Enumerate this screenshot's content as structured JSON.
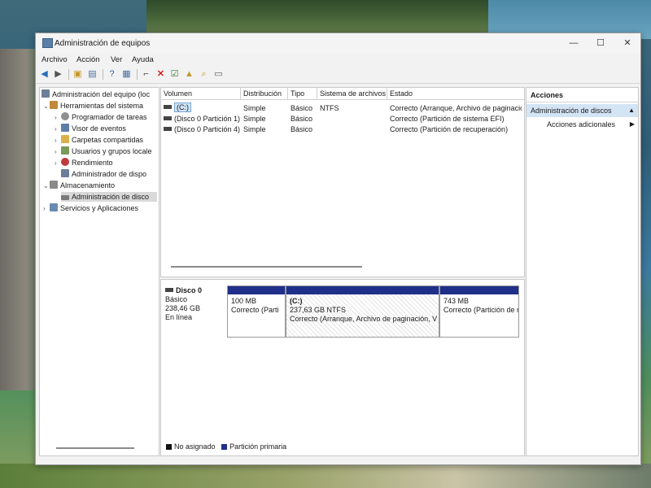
{
  "window": {
    "title": "Administración de equipos"
  },
  "controls": {
    "minimize": "—",
    "maximize": "☐",
    "close": "✕"
  },
  "menu": [
    "Archivo",
    "Acción",
    "Ver",
    "Ayuda"
  ],
  "tree": {
    "root": "Administración del equipo (loc",
    "system_tools": "Herramientas del sistema",
    "task_scheduler": "Programador de tareas",
    "event_viewer": "Visor de eventos",
    "shared_folders": "Carpetas compartidas",
    "local_users": "Usuarios y grupos locale",
    "performance": "Rendimiento",
    "device_manager": "Administrador de dispo",
    "storage": "Almacenamiento",
    "disk_management": "Administración de disco",
    "services": "Servicios y Aplicaciones"
  },
  "volume_table": {
    "columns": [
      "Volumen",
      "Distribución",
      "Tipo",
      "Sistema de archivos",
      "Estado"
    ],
    "rows": [
      {
        "volume": "(C:)",
        "layout": "Simple",
        "type": "Básico",
        "fs": "NTFS",
        "status": "Correcto (Arranque, Archivo de paginació"
      },
      {
        "volume": "(Disco 0 Partición 1)",
        "layout": "Simple",
        "type": "Básico",
        "fs": "",
        "status": "Correcto (Partición de sistema EFI)"
      },
      {
        "volume": "(Disco 0 Partición 4)",
        "layout": "Simple",
        "type": "Básico",
        "fs": "",
        "status": "Correcto (Partición de recuperación)"
      }
    ]
  },
  "disk": {
    "name": "Disco 0",
    "type": "Básico",
    "size": "238,46 GB",
    "state": "En línea",
    "partitions": [
      {
        "label": "",
        "size": "100 MB",
        "status": "Correcto (Parti"
      },
      {
        "label": "(C:)",
        "size": "237,63 GB NTFS",
        "status": "Correcto (Arranque, Archivo de paginación, V"
      },
      {
        "label": "",
        "size": "743 MB",
        "status": "Correcto (Partición de r"
      }
    ]
  },
  "legend": {
    "unallocated": "No asignado",
    "primary": "Partición primaria"
  },
  "actions": {
    "header": "Acciones",
    "section": "Administración de discos",
    "more": "Acciones adicionales"
  },
  "colors": {
    "primary_partition": "#1f2f8a",
    "unallocated": "#111111",
    "selection": "#d3e4f5"
  }
}
